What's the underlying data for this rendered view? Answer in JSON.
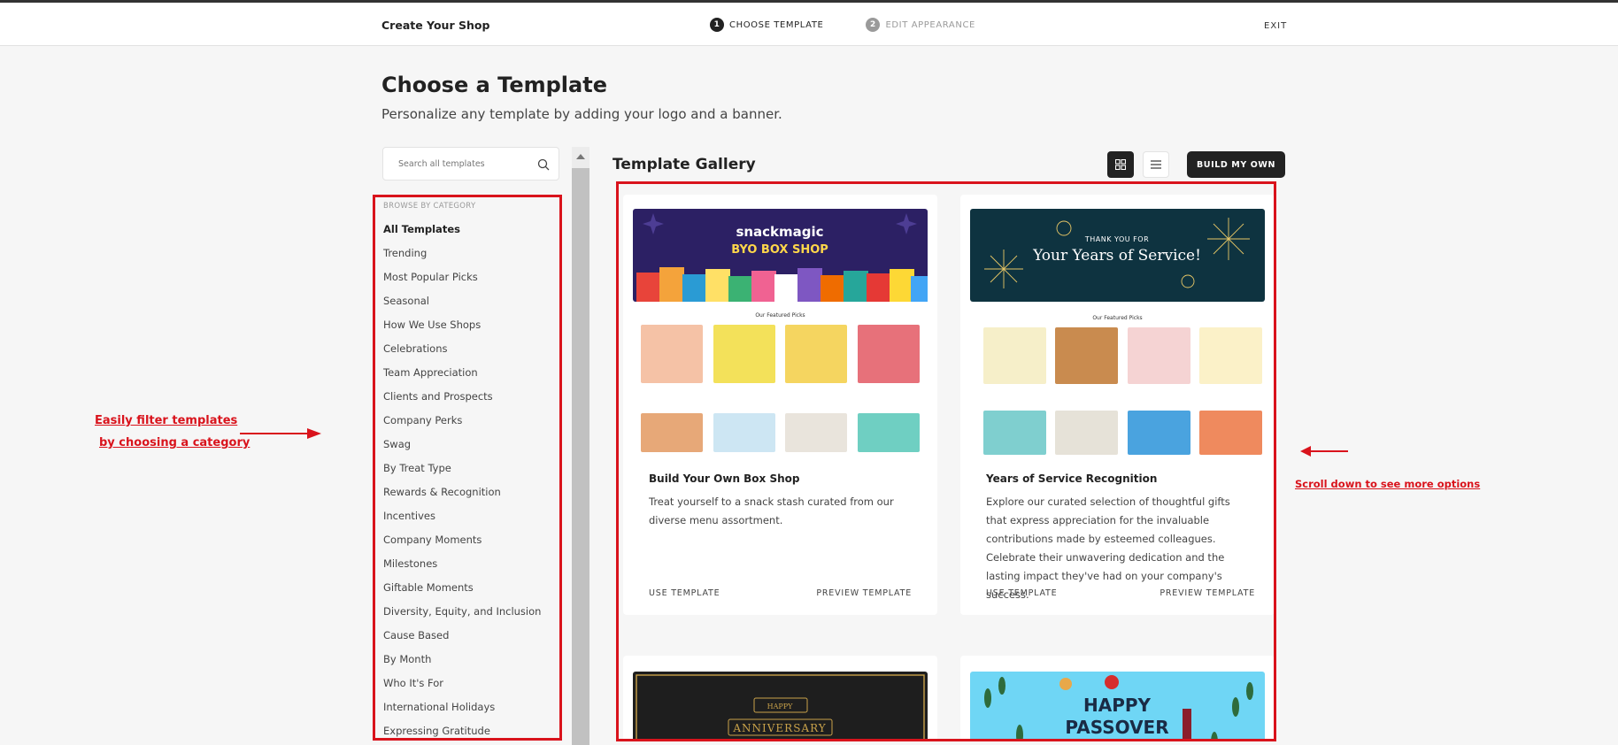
{
  "header": {
    "brand": "Create Your Shop",
    "steps": [
      {
        "num": "1",
        "label": "CHOOSE TEMPLATE"
      },
      {
        "num": "2",
        "label": "EDIT APPEARANCE"
      }
    ],
    "exit_label": "EXIT"
  },
  "page": {
    "title": "Choose a Template",
    "subtitle": "Personalize any template by adding your logo and a banner."
  },
  "search": {
    "placeholder": "Search all templates"
  },
  "categories": {
    "heading": "BROWSE BY CATEGORY",
    "items": [
      "All Templates",
      "Trending",
      "Most Popular Picks",
      "Seasonal",
      "How We Use Shops",
      "Celebrations",
      "Team Appreciation",
      "Clients and Prospects",
      "Company Perks",
      "Swag",
      "By Treat Type",
      "Rewards & Recognition",
      "Incentives",
      "Company Moments",
      "Milestones",
      "Giftable Moments",
      "Diversity, Equity, and Inclusion",
      "Cause Based",
      "By Month",
      "Who It's For",
      "International Holidays",
      "Expressing Gratitude"
    ]
  },
  "gallery": {
    "title": "Template Gallery",
    "build_own_label": "BUILD MY OWN",
    "use_label": "USE TEMPLATE",
    "preview_label": "PREVIEW TEMPLATE",
    "cards": [
      {
        "banner_brand": "snackmagic",
        "banner_text": "BYO BOX SHOP",
        "featured_heading": "Our Featured Picks",
        "title": "Build Your Own Box Shop",
        "description": "Treat yourself to a snack stash curated from our diverse menu assortment."
      },
      {
        "banner_line1": "THANK YOU FOR",
        "banner_line2": "Your Years of Service!",
        "featured_heading": "Our Featured Picks",
        "title": "Years of Service Recognition",
        "description": "Explore our curated selection of thoughtful gifts that express appreciation for the invaluable contributions made by esteemed colleagues. Celebrate their unwavering dedication and the lasting impact they've had on your company's success."
      },
      {
        "banner_line1": "HAPPY",
        "banner_line2": "ANNIVERSARY"
      },
      {
        "banner_line1": "HAPPY",
        "banner_line2": "PASSOVER"
      }
    ]
  },
  "annotations": {
    "left_line1": "Easily filter templates",
    "left_line2": "by choosing a category",
    "right": "Scroll down to see more options"
  },
  "colors": {
    "accent_red": "#d9131c",
    "dark": "#222222",
    "banner_navy": "#2c2064",
    "banner_teal": "#0e3340",
    "banner_sky": "#6fd6f5"
  }
}
